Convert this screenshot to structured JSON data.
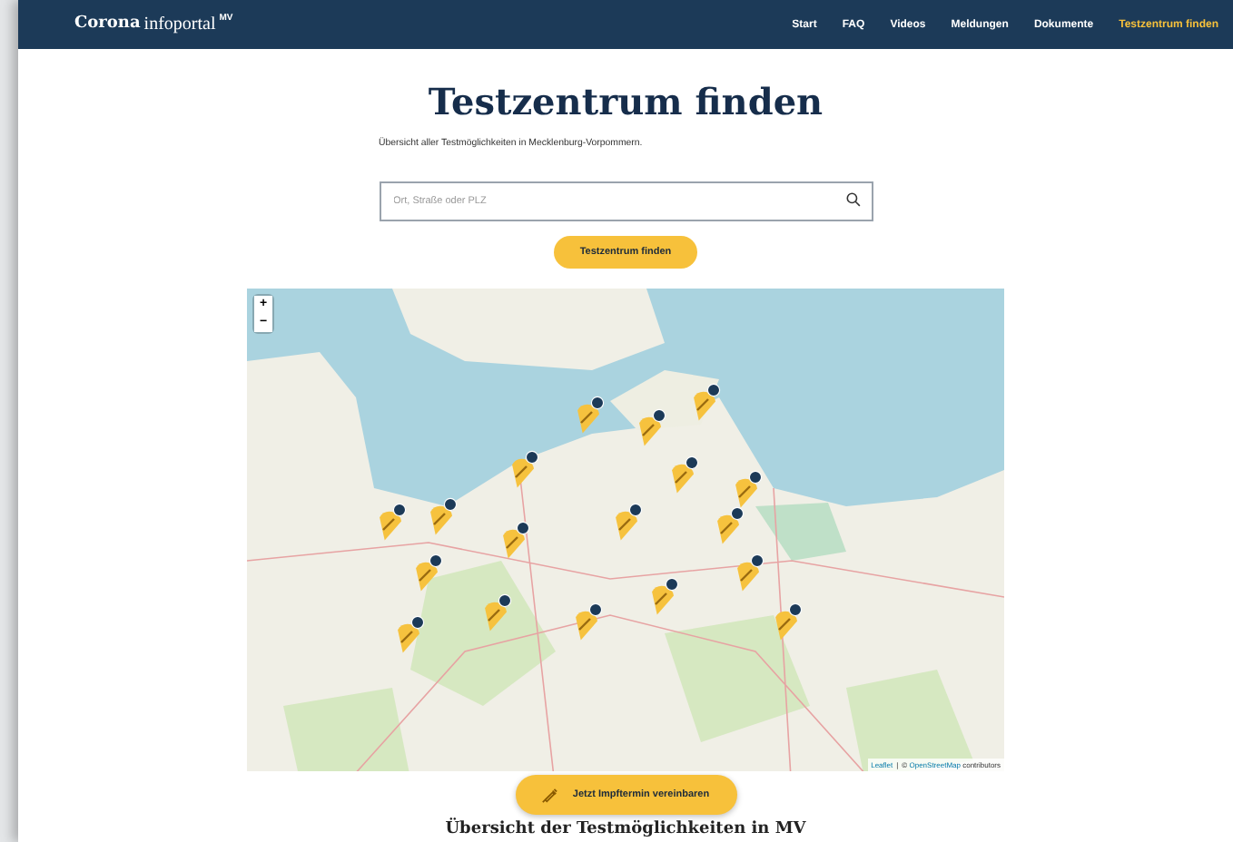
{
  "header": {
    "logo": {
      "brand": "Corona",
      "product": "infoportal",
      "badge": "MV"
    },
    "nav": [
      {
        "label": "Start",
        "selected": false
      },
      {
        "label": "FAQ",
        "selected": false
      },
      {
        "label": "Videos",
        "selected": false
      },
      {
        "label": "Meldungen",
        "selected": false
      },
      {
        "label": "Dokumente",
        "selected": false
      },
      {
        "label": "Testzentrum finden",
        "selected": true
      }
    ]
  },
  "title": "Testzentrum finden",
  "subtitle": "Übersicht aller Testmöglichkeiten in Mecklenburg-Vorpommern.",
  "search": {
    "placeholder": "Ort, Straße oder PLZ"
  },
  "search_button": "Testzentrum finden",
  "map": {
    "zoom_in": "+",
    "zoom_out": "−",
    "attribution_link": "Leaflet",
    "attribution_separator": "|",
    "attribution_text": "© ",
    "attribution_osm": "OpenStreetMap",
    "attribution_suffix": " contributors"
  },
  "floating_button": "Jetzt Impftermin vereinbaren",
  "section_heading": "Übersicht der Testmöglichkeiten in MV"
}
